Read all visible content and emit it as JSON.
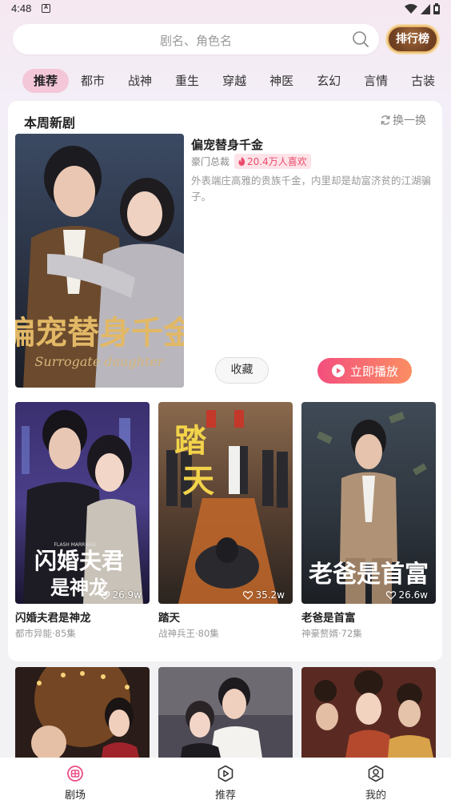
{
  "status": {
    "time": "4:48",
    "notif_glyph": "A"
  },
  "search": {
    "placeholder": "剧名、角色名",
    "rank_label": "排行榜"
  },
  "categories": [
    "推荐",
    "都市",
    "战神",
    "重生",
    "穿越",
    "神医",
    "玄幻",
    "言情",
    "古装"
  ],
  "weekly": {
    "section_title": "本周新剧",
    "refresh_label": "换一换",
    "featured": {
      "title": "偏宠替身千金",
      "genre": "豪门总裁",
      "likes": "20.4万人喜欢",
      "description": "外表端庄高雅的贵族千金，内里却是劫富济贫的江湖骗子。",
      "poster_text": "偏宠替身千金",
      "poster_subtext": "Surrogate daughter",
      "collect_label": "收藏",
      "play_label": "立即播放"
    },
    "grid": [
      {
        "title": "闪婚夫君是神龙",
        "sub": "都市异能·85集",
        "likes": "26.9w",
        "poster_text_1": "闪婚夫君",
        "poster_text_2": "是神龙",
        "poster_en": "FLASH MARRIAGE"
      },
      {
        "title": "踏天",
        "sub": "战神兵王·80集",
        "likes": "35.2w",
        "poster_text_1": "踏",
        "poster_text_2": "天"
      },
      {
        "title": "老爸是首富",
        "sub": "神豪赘婿·72集",
        "likes": "26.6w",
        "poster_text_1": "老爸是首富"
      }
    ]
  },
  "nav": [
    {
      "label": "剧场",
      "icon": "theater-icon",
      "active": true
    },
    {
      "label": "推荐",
      "icon": "play-circle-icon",
      "active": false
    },
    {
      "label": "我的",
      "icon": "profile-icon",
      "active": false
    }
  ],
  "colors": {
    "accent_pink": "#f4c7d8",
    "play_gradient_start": "#f34f7e",
    "play_gradient_end": "#fb8e62",
    "like_red": "#ea4a6b",
    "nav_active": "#e94d86"
  }
}
